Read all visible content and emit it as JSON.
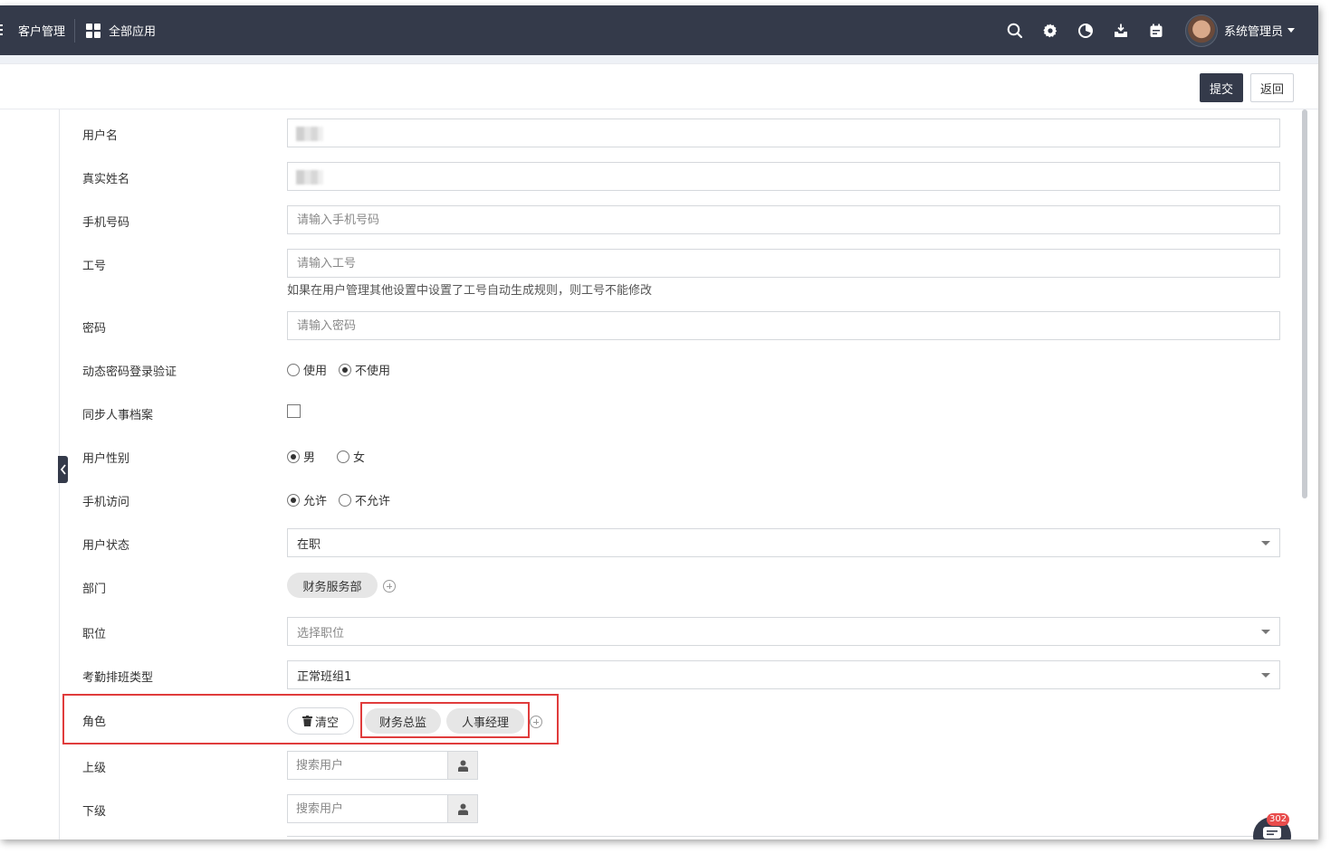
{
  "nav": {
    "crm": "客户管理",
    "apps": "全部应用",
    "user_name": "系统管理员",
    "icons": [
      "search-icon",
      "gear-icon",
      "pie-chart-icon",
      "inbox-icon",
      "calendar-icon"
    ]
  },
  "toolbar": {
    "submit": "提交",
    "back": "返回"
  },
  "form": {
    "username": {
      "label": "用户名"
    },
    "realname": {
      "label": "真实姓名"
    },
    "phone": {
      "label": "手机号码",
      "placeholder": "请输入手机号码"
    },
    "jobno": {
      "label": "工号",
      "placeholder": "请输入工号",
      "hint": "如果在用户管理其他设置中设置了工号自动生成规则，则工号不能修改"
    },
    "password": {
      "label": "密码",
      "placeholder": "请输入密码"
    },
    "otp": {
      "label": "动态密码登录验证",
      "options": [
        "使用",
        "不使用"
      ],
      "selected": "不使用"
    },
    "sync_hr": {
      "label": "同步人事档案",
      "checked": false
    },
    "gender": {
      "label": "用户性别",
      "options": [
        "男",
        "女"
      ],
      "selected": "男"
    },
    "mobile_access": {
      "label": "手机访问",
      "options": [
        "允许",
        "不允许"
      ],
      "selected": "允许"
    },
    "status": {
      "label": "用户状态",
      "value": "在职"
    },
    "department": {
      "label": "部门",
      "tags": [
        "财务服务部"
      ]
    },
    "position": {
      "label": "职位",
      "placeholder": "选择职位"
    },
    "shift": {
      "label": "考勤排班类型",
      "value": "正常班组1"
    },
    "role": {
      "label": "角色",
      "clear": "清空",
      "tags": [
        "财务总监",
        "人事经理"
      ]
    },
    "superior": {
      "label": "上级",
      "placeholder": "搜索用户"
    },
    "subordinate": {
      "label": "下级",
      "placeholder": "搜索用户"
    }
  },
  "chat": {
    "count": "302"
  },
  "colors": {
    "nav_bg": "#343a4a",
    "highlight": "#e03c3c",
    "badge": "#e84c4c"
  }
}
